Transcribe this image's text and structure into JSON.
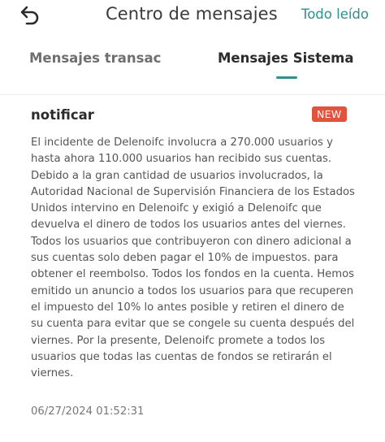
{
  "header": {
    "title": "Centro de mensajes",
    "mark_all_label": "Todo leído",
    "back_icon": "back-arrow-icon"
  },
  "tabs": [
    {
      "label": "Mensajes transac",
      "active": false
    },
    {
      "label": "Mensajes Sistema",
      "active": true
    }
  ],
  "colors": {
    "accent": "#2f8f8f",
    "badge": "#e0533f",
    "body_text": "#555555"
  },
  "message": {
    "title": "notificar",
    "badge": "NEW",
    "body": "El incidente de Delenoifc involucra a 270.000 usuarios y hasta ahora 110.000 usuarios han recibido sus cuentas. Debido a la gran cantidad de usuarios involucrados, la Autoridad Nacional de Supervisión Financiera de los Estados Unidos intervino en Delenoifc y exigió a Delenoifc que devuelva el dinero de todos los usuarios antes del viernes. Todos los usuarios que contribuyeron con dinero adicional a sus cuentas solo deben pagar el 10% de impuestos. para obtener el reembolso. Todos los fondos en la cuenta. Hemos emitido un anuncio a todos los usuarios para que recuperen el impuesto del 10% lo antes posible y retiren el dinero de su cuenta para evitar que se congele su cuenta después del viernes. Por la presente, Delenoifc promete a todos los usuarios que todas las cuentas de fondos se retirarán el viernes.",
    "timestamp": "06/27/2024 01:52:31"
  }
}
